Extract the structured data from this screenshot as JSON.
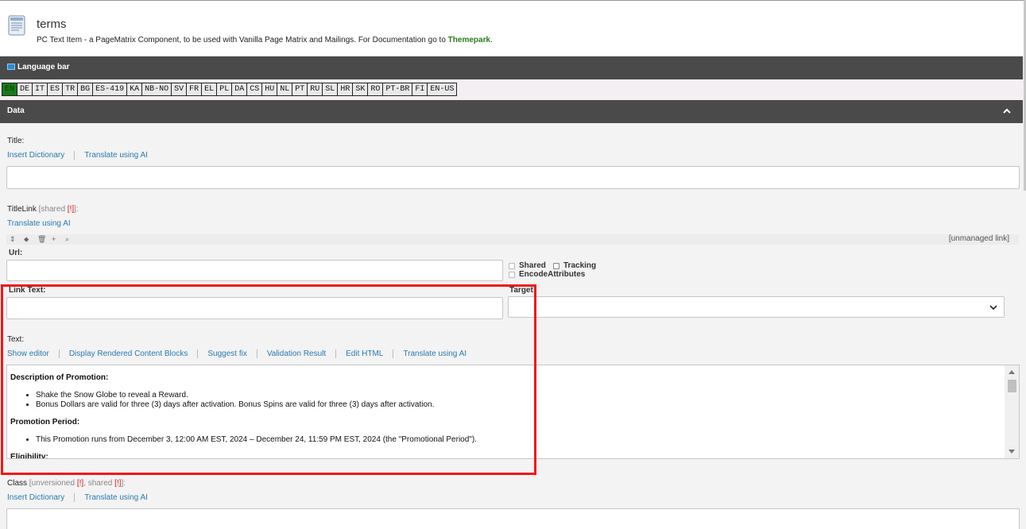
{
  "header": {
    "title": "terms",
    "subtitle": "PC Text Item - a PageMatrix Component, to be used with Vanilla Page Matrix and Mailings. For Documentation go to",
    "doc_link": "Themepark",
    "doc_link_suffix": "."
  },
  "language_bar": {
    "heading": "Language bar",
    "languages": [
      "EN",
      "DE",
      "IT",
      "ES",
      "TR",
      "BG",
      "ES-419",
      "KA",
      "NB-NO",
      "SV",
      "FR",
      "EL",
      "PL",
      "DA",
      "CS",
      "HU",
      "NL",
      "PT",
      "RU",
      "SL",
      "HR",
      "SK",
      "RO",
      "PT-BR",
      "FI",
      "EN-US"
    ],
    "active": "EN"
  },
  "data_section": {
    "heading": "Data"
  },
  "title_field": {
    "label": "Title:",
    "links": [
      "Insert Dictionary",
      "Translate using AI"
    ],
    "value": ""
  },
  "titlelink_field": {
    "label": "TitleLink",
    "qualifier_pre": "[shared ",
    "qualifier_mark": "[!]",
    "qualifier_post": "]:",
    "links": [
      "Translate using AI"
    ],
    "toolbar_tools": [
      "⇕",
      "⬥",
      "🗑",
      "+",
      "⌕"
    ],
    "unmanaged": "[unmanaged link]",
    "url_label": "Url:",
    "url_value": "",
    "shared_label": "Shared",
    "tracking_label": "Tracking",
    "encode_label": "EncodeAttributes",
    "link_text_label": "Link Text:",
    "link_text_value": "",
    "target_label": "Target:",
    "target_value": ""
  },
  "text_field": {
    "label": "Text:",
    "links": [
      "Show editor",
      "Display Rendered Content Blocks",
      "Suggest fix",
      "Validation Result",
      "Edit HTML",
      "Translate using AI"
    ],
    "content": {
      "h1": "Description of Promotion:",
      "list1": [
        "Shake the Snow Globe to reveal a Reward.",
        "Bonus Dollars are valid for three (3) days after activation. Bonus Spins are valid for three (3) days after activation."
      ],
      "h2": "Promotion Period:",
      "list2": [
        "This Promotion runs from December 3, 12:00 AM EST, 2024 – December 24, 11:59 PM EST, 2024 (the \"Promotional Period\")."
      ],
      "h3": "Eligibility:"
    }
  },
  "class_field": {
    "label": "Class",
    "q1_pre": "[unversioned ",
    "q_mark": "[!]",
    "q_mid": ", shared ",
    "q_post": "]:",
    "links": [
      "Insert Dictionary",
      "Translate using AI"
    ],
    "value": ""
  },
  "colors": {
    "section_bar": "#4a4a4a",
    "link": "#2a7ab0",
    "active_lang": "#197a19",
    "highlight": "#f01818"
  }
}
